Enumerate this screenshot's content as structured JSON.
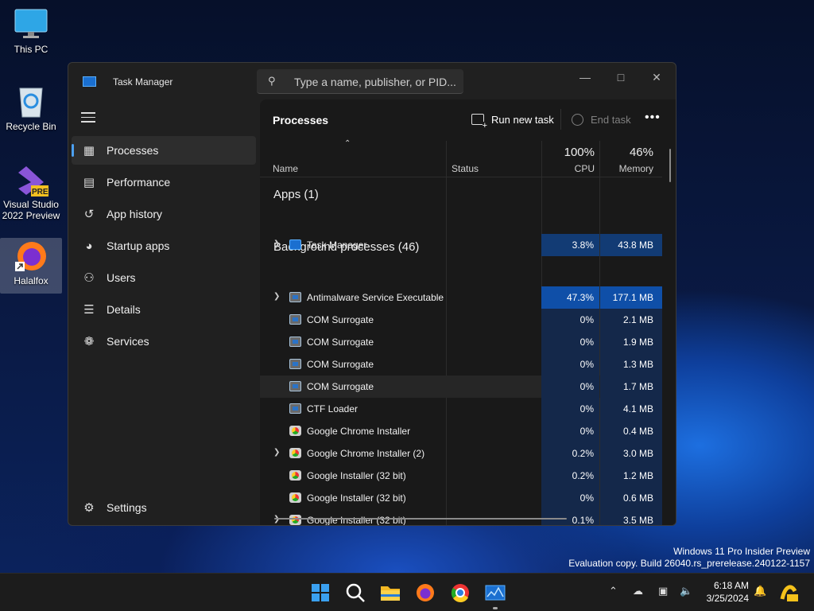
{
  "desktop": {
    "icons": [
      {
        "label": "This PC"
      },
      {
        "label": "Recycle Bin"
      },
      {
        "label": "Visual Studio 2022 Preview",
        "badge": "PRE"
      },
      {
        "label": "Halalfox"
      }
    ]
  },
  "watermark": {
    "line1": "Windows 11 Pro Insider Preview",
    "line2": "Evaluation copy. Build 26040.rs_prerelease.240122-1157"
  },
  "window": {
    "title": "Task Manager",
    "search_placeholder": "Type a name, publisher, or PID..."
  },
  "sidebar": {
    "items": [
      {
        "label": "Processes",
        "icon": "processes-icon",
        "active": true
      },
      {
        "label": "Performance",
        "icon": "performance-icon"
      },
      {
        "label": "App history",
        "icon": "history-icon"
      },
      {
        "label": "Startup apps",
        "icon": "startup-icon"
      },
      {
        "label": "Users",
        "icon": "users-icon"
      },
      {
        "label": "Details",
        "icon": "details-icon"
      },
      {
        "label": "Services",
        "icon": "services-icon"
      }
    ],
    "settings": "Settings"
  },
  "main": {
    "title": "Processes",
    "run_new_task": "Run new task",
    "end_task": "End task"
  },
  "columns": {
    "name": "Name",
    "status": "Status",
    "cpu_pct": "100%",
    "cpu": "CPU",
    "mem_pct": "46%",
    "memory": "Memory"
  },
  "groups": {
    "apps": "Apps (1)",
    "background": "Background processes (46)"
  },
  "rows": [
    {
      "name": "Task Manager",
      "cpu": "3.8%",
      "mem": "43.8 MB",
      "expand": true,
      "icon": "tm"
    },
    {
      "name": "Antimalware Service Executable",
      "cpu": "47.3%",
      "mem": "177.1 MB",
      "expand": true,
      "icon": "win"
    },
    {
      "name": "COM Surrogate",
      "cpu": "0%",
      "mem": "2.1 MB",
      "expand": false,
      "icon": "win"
    },
    {
      "name": "COM Surrogate",
      "cpu": "0%",
      "mem": "1.9 MB",
      "expand": false,
      "icon": "win"
    },
    {
      "name": "COM Surrogate",
      "cpu": "0%",
      "mem": "1.3 MB",
      "expand": false,
      "icon": "win"
    },
    {
      "name": "COM Surrogate",
      "cpu": "0%",
      "mem": "1.7 MB",
      "expand": false,
      "icon": "win"
    },
    {
      "name": "CTF Loader",
      "cpu": "0%",
      "mem": "4.1 MB",
      "expand": false,
      "icon": "win"
    },
    {
      "name": "Google Chrome Installer",
      "cpu": "0%",
      "mem": "0.4 MB",
      "expand": false,
      "icon": "g"
    },
    {
      "name": "Google Chrome Installer (2)",
      "cpu": "0.2%",
      "mem": "3.0 MB",
      "expand": true,
      "icon": "g"
    },
    {
      "name": "Google Installer (32 bit)",
      "cpu": "0.2%",
      "mem": "1.2 MB",
      "expand": false,
      "icon": "g"
    },
    {
      "name": "Google Installer (32 bit)",
      "cpu": "0%",
      "mem": "0.6 MB",
      "expand": false,
      "icon": "g"
    },
    {
      "name": "Google Installer (32 bit)",
      "cpu": "0.1%",
      "mem": "3.5 MB",
      "expand": true,
      "icon": "g"
    }
  ],
  "colors": {
    "heat_high": "#0f4fa8",
    "heat_mid": "#123b74",
    "heat_low": "#14284a",
    "accent": "#4ca0f0"
  },
  "taskbar": {
    "apps": [
      "start-icon",
      "search-icon",
      "file-explorer-icon",
      "firefox-icon",
      "chrome-icon",
      "task-manager-icon"
    ],
    "time": "6:18 AM",
    "date": "3/25/2024"
  }
}
